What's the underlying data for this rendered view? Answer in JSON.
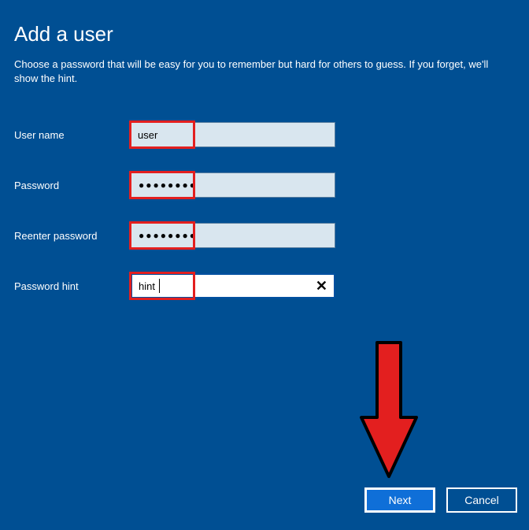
{
  "title": "Add a user",
  "subtitle": "Choose a password that will be easy for you to remember but hard for others to guess. If you forget, we'll show the hint.",
  "form": {
    "username": {
      "label": "User name",
      "value": "user"
    },
    "password": {
      "label": "Password",
      "masked": "●●●●●●●●"
    },
    "reenter": {
      "label": "Reenter password",
      "masked": "●●●●●●●●"
    },
    "hint": {
      "label": "Password hint",
      "value": "hint"
    }
  },
  "buttons": {
    "next": "Next",
    "cancel": "Cancel"
  }
}
